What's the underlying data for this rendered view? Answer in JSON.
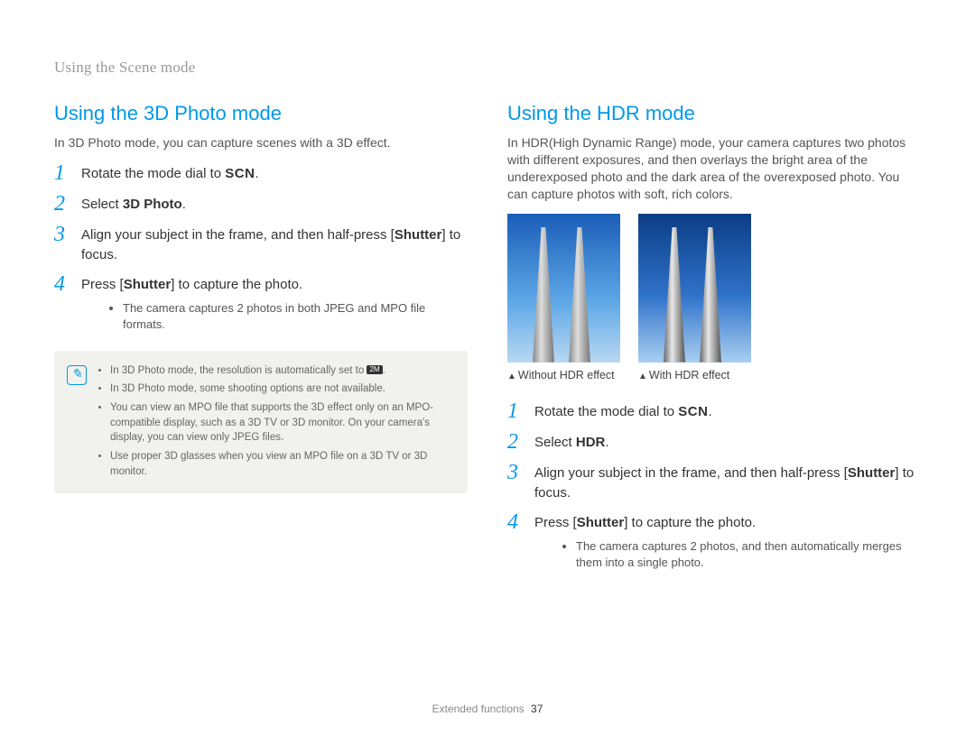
{
  "header": "Using the Scene mode",
  "left": {
    "title": "Using the 3D Photo mode",
    "intro": "In 3D Photo mode, you can capture scenes with a 3D effect.",
    "steps": {
      "s1_a": "Rotate the mode dial to ",
      "s1_scn": "SCN",
      "s1_b": ".",
      "s2_a": "Select ",
      "s2_bold": "3D Photo",
      "s2_b": ".",
      "s3_a": "Align your subject in the frame, and then half-press [",
      "s3_bold": "Shutter",
      "s3_b": "] to focus.",
      "s4_a": "Press [",
      "s4_bold": "Shutter",
      "s4_b": "] to capture the photo.",
      "s4_bullet": "The camera captures 2 photos in both JPEG and MPO file formats."
    },
    "notes": {
      "n1_a": "In 3D Photo mode, the resolution is automatically set to ",
      "n1_chip": "2M",
      "n1_b": ".",
      "n2": "In 3D Photo mode, some shooting options are not available.",
      "n3": "You can view an MPO file that supports the 3D effect only on an MPO-compatible display, such as a 3D TV or 3D monitor. On your camera's display, you can view only JPEG files.",
      "n4": "Use proper 3D glasses when you view an MPO file on a 3D TV or 3D monitor."
    }
  },
  "right": {
    "title": "Using the HDR mode",
    "intro": "In HDR(High Dynamic Range) mode, your camera captures two photos with different exposures, and then overlays the bright area of the underexposed photo and the dark area of the overexposed photo. You can capture photos with soft, rich colors.",
    "caption1": "Without HDR effect",
    "caption2": "With HDR effect",
    "steps": {
      "s1_a": "Rotate the mode dial to ",
      "s1_scn": "SCN",
      "s1_b": ".",
      "s2_a": "Select ",
      "s2_bold": "HDR",
      "s2_b": ".",
      "s3_a": "Align your subject in the frame, and then half-press [",
      "s3_bold": "Shutter",
      "s3_b": "] to focus.",
      "s4_a": "Press [",
      "s4_bold": "Shutter",
      "s4_b": "] to capture the photo.",
      "s4_bullet": "The camera captures 2 photos, and then automatically merges them into a single photo."
    }
  },
  "footer": {
    "section": "Extended functions",
    "page": "37"
  },
  "nums": {
    "n1": "1",
    "n2": "2",
    "n3": "3",
    "n4": "4"
  }
}
